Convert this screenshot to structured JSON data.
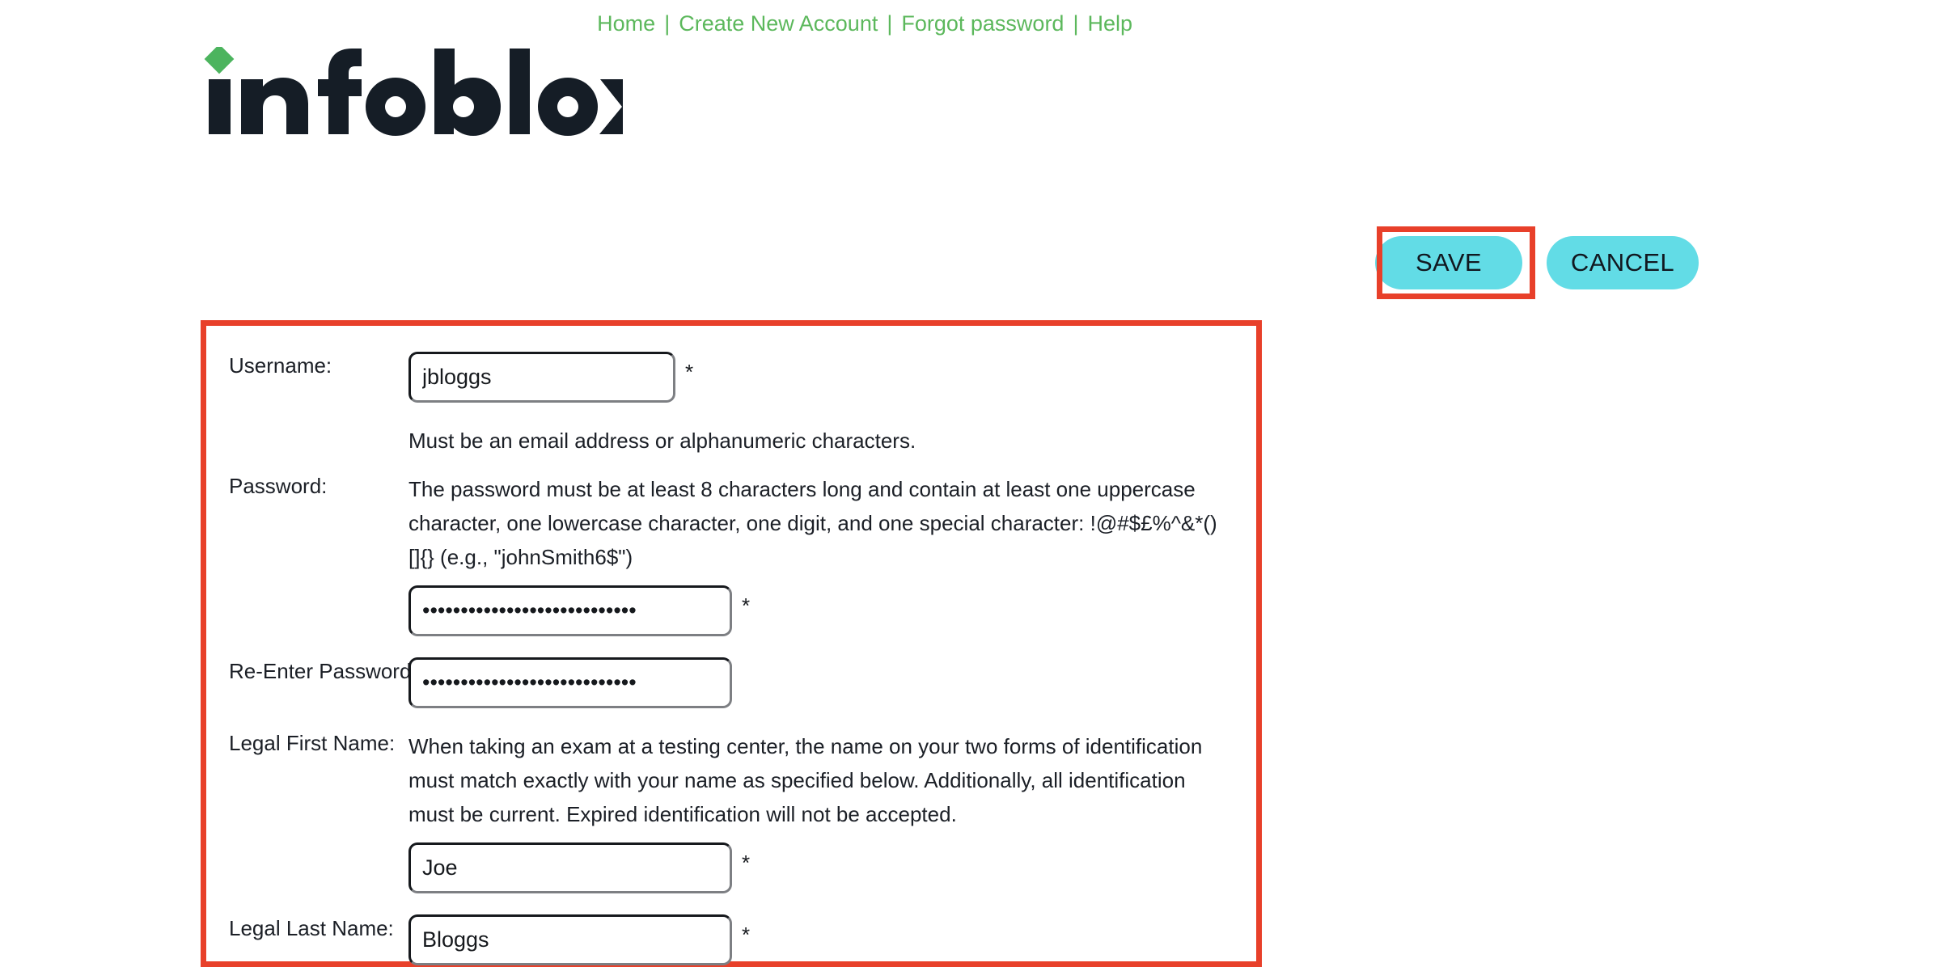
{
  "topnav": {
    "links": [
      "Home",
      "Create New Account",
      "Forgot password",
      "Help"
    ],
    "separator": "|",
    "link_color": "#5cb85c"
  },
  "brand": {
    "name": "infoblox",
    "registered_mark": "®",
    "wordmark_color": "#151d26",
    "accent_diamond_color": "#4cb45e"
  },
  "toolbar": {
    "save_label": "SAVE",
    "cancel_label": "CANCEL",
    "button_color": "#62dce6",
    "highlight_color": "#e8402a"
  },
  "form": {
    "required_marker": "*",
    "fields": {
      "username": {
        "label": "Username:",
        "value": "jbloggs",
        "placeholder": "",
        "help": "Must be an email address or alphanumeric characters."
      },
      "password": {
        "label": "Password:",
        "value": "••••••••••••••••••••••••••••",
        "placeholder": "",
        "help": "The password must be at least 8 characters long and contain at least one uppercase character, one lowercase character, one digit, and one special character: !@#$£%^&*()[]{} (e.g., \"johnSmith6$\")"
      },
      "reenter_password": {
        "label": "Re-Enter Password",
        "value": "••••••••••••••••••••••••••••",
        "placeholder": ""
      },
      "legal_first_name": {
        "label": "Legal First Name:",
        "value": "Joe",
        "placeholder": "",
        "help": "When taking an exam at a testing center, the name on your two forms of identification must match exactly with your name as specified below. Additionally, all identification must be current. Expired identification will not be accepted."
      },
      "legal_last_name": {
        "label": "Legal Last Name:",
        "value": "Bloggs",
        "placeholder": ""
      }
    }
  }
}
